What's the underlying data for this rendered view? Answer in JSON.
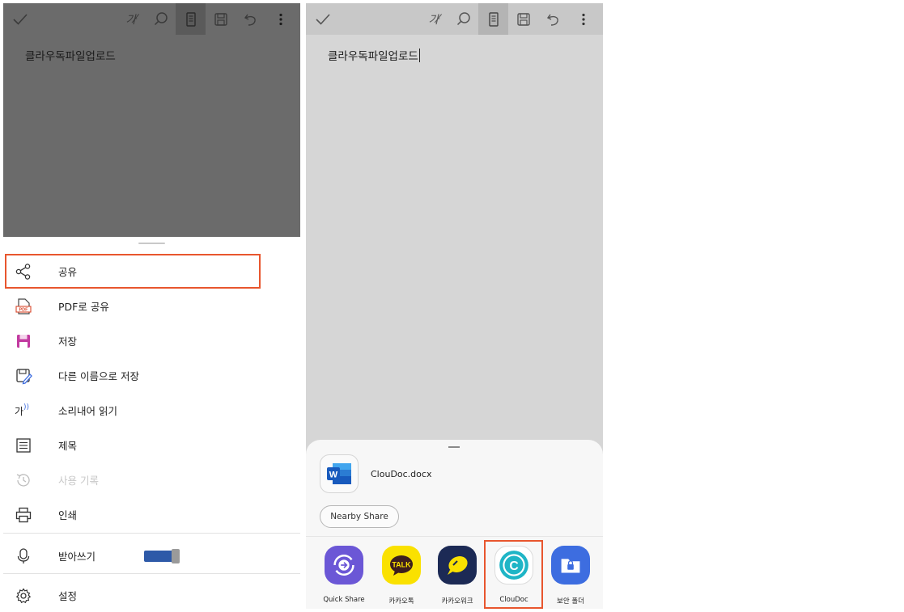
{
  "left_screen": {
    "doc_text": "클라우독파일업로드",
    "toolbar": {
      "pen_label": "가"
    },
    "menu": [
      {
        "id": "share",
        "label": "공유",
        "icon": "share-icon",
        "disabled": false
      },
      {
        "id": "share-pdf",
        "label": "PDF로 공유",
        "icon": "pdf-icon",
        "icon_text": "PDF",
        "disabled": false
      },
      {
        "id": "save",
        "label": "저장",
        "icon": "save-icon",
        "disabled": false
      },
      {
        "id": "save-as",
        "label": "다른 이름으로 저장",
        "icon": "save-as-icon",
        "disabled": false
      },
      {
        "id": "read-aloud",
        "label": "소리내어 읽기",
        "icon": "read-aloud-icon",
        "icon_text": "가",
        "disabled": false
      },
      {
        "id": "headings",
        "label": "제목",
        "icon": "headings-icon",
        "disabled": false
      },
      {
        "id": "history",
        "label": "사용 기록",
        "icon": "history-icon",
        "disabled": true
      },
      {
        "id": "print",
        "label": "인쇄",
        "icon": "print-icon",
        "disabled": false
      },
      {
        "id": "dictation",
        "label": "받아쓰기",
        "icon": "microphone-icon",
        "disabled": false,
        "toggle": "on"
      },
      {
        "id": "settings",
        "label": "설정",
        "icon": "gear-icon",
        "disabled": false
      }
    ]
  },
  "right_screen": {
    "doc_text": "클라우독파일업로드",
    "toolbar": {
      "pen_label": "가"
    },
    "share_sheet": {
      "file_name": "ClouDoc.docx",
      "file_icon_text": "W",
      "nearby_share_label": "Nearby Share",
      "apps": [
        {
          "label": "Quick Share",
          "icon": "quick-share-icon",
          "color": "#6b57d6"
        },
        {
          "label": "카카오톡",
          "icon": "kakaotalk-icon",
          "icon_text": "TALK",
          "color": "#fae100"
        },
        {
          "label": "카카오워크",
          "icon": "kakaowork-icon",
          "color": "#1c2a55"
        },
        {
          "label": "ClouDoc",
          "icon": "cloudoc-icon",
          "icon_text": "C",
          "color": "#1fb5c6"
        },
        {
          "label": "보안 폴더",
          "icon": "secure-folder-icon",
          "color": "#3d6de0"
        }
      ]
    }
  },
  "colors": {
    "highlight": "#e8562e",
    "toggle_track": "#2e5aa8"
  }
}
